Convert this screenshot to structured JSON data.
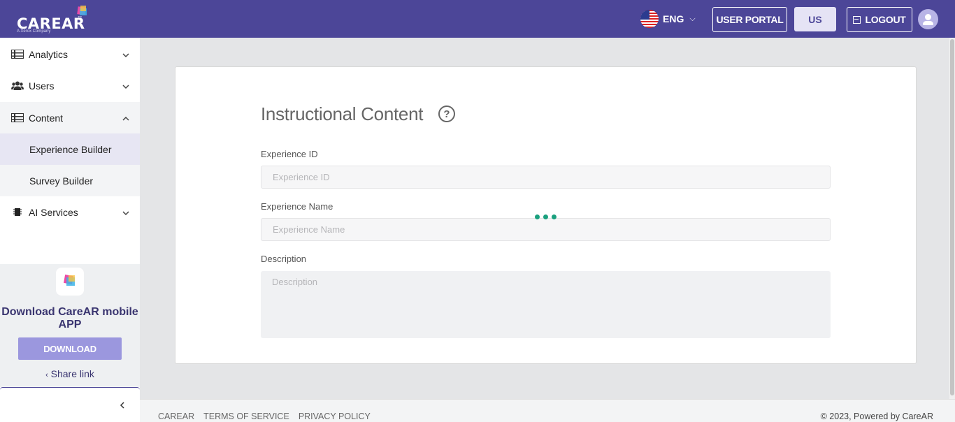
{
  "header": {
    "logo": {
      "brand": "CAREAR",
      "tm": "™",
      "sub": "A Xerox Company"
    },
    "language": {
      "code": "ENG",
      "flag_icon": "us-flag-icon"
    },
    "user_portal_label": "USER PORTAL",
    "region_label": "US",
    "logout_label": "LOGOUT",
    "colors": {
      "bar": "#4c4698",
      "accent_light": "#e5e3f5"
    }
  },
  "sidebar": {
    "items": [
      {
        "label": "Analytics",
        "icon": "table-icon",
        "expanded": false
      },
      {
        "label": "Users",
        "icon": "users-icon",
        "expanded": false
      },
      {
        "label": "Content",
        "icon": "table-icon",
        "expanded": true
      },
      {
        "label": "Experience Builder",
        "sub": true,
        "active": true
      },
      {
        "label": "Survey Builder",
        "sub": true
      },
      {
        "label": "AI Services",
        "icon": "chip-icon",
        "expanded": false
      }
    ],
    "promo": {
      "title": "Download CareAR mobile APP",
      "download_label": "DOWNLOAD",
      "share_label": "Share link"
    }
  },
  "main": {
    "title": "Instructional Content",
    "fields": {
      "experience_id": {
        "label": "Experience ID",
        "placeholder": "Experience ID",
        "value": ""
      },
      "experience_name": {
        "label": "Experience Name",
        "placeholder": "Experience Name",
        "value": ""
      },
      "description": {
        "label": "Description",
        "placeholder": "Description",
        "value": ""
      }
    },
    "loading": true,
    "loader_color": "#1aa07e"
  },
  "footer": {
    "links": [
      "CAREAR",
      "TERMS OF SERVICE",
      "PRIVACY POLICY"
    ],
    "copyright": "© 2023, Powered by CareAR"
  }
}
